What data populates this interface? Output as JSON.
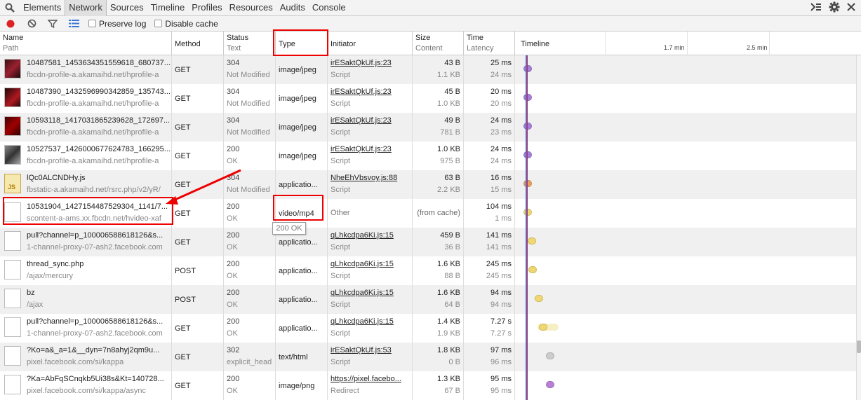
{
  "tabs": [
    "Elements",
    "Network",
    "Sources",
    "Timeline",
    "Profiles",
    "Resources",
    "Audits",
    "Console"
  ],
  "toolbar": {
    "preserve_log": "Preserve log",
    "disable_cache": "Disable cache"
  },
  "header": {
    "name": "Name",
    "path": "Path",
    "method": "Method",
    "status": "Status",
    "text": "Text",
    "type": "Type",
    "initiator": "Initiator",
    "size": "Size",
    "content": "Content",
    "time": "Time",
    "latency": "Latency",
    "timeline": "Timeline",
    "tick1": "1.7 min",
    "tick2": "2.5 min"
  },
  "tooltip": "200 OK",
  "rows": [
    {
      "name": "10487581_1453634351559618_680737...",
      "path": "fbcdn-profile-a.akamaihd.net/hprofile-a",
      "method": "GET",
      "status": "304",
      "text": "Not Modified",
      "type": "image/jpeg",
      "initiator": "irESaktQkUf.js:23",
      "init_type": "Script",
      "size": "43 B",
      "content": "1.1 KB",
      "time": "25 ms",
      "latency": "24 ms",
      "dot_color": "#a77fd6"
    },
    {
      "name": "10487390_1432596990342859_135743...",
      "path": "fbcdn-profile-a.akamaihd.net/hprofile-a",
      "method": "GET",
      "status": "304",
      "text": "Not Modified",
      "type": "image/jpeg",
      "initiator": "irESaktQkUf.js:23",
      "init_type": "Script",
      "size": "45 B",
      "content": "1.0 KB",
      "time": "20 ms",
      "latency": "20 ms",
      "dot_color": "#a77fd6"
    },
    {
      "name": "10593118_1417031865239628_172697...",
      "path": "fbcdn-profile-a.akamaihd.net/hprofile-a",
      "method": "GET",
      "status": "304",
      "text": "Not Modified",
      "type": "image/jpeg",
      "initiator": "irESaktQkUf.js:23",
      "init_type": "Script",
      "size": "49 B",
      "content": "781 B",
      "time": "24 ms",
      "latency": "23 ms",
      "dot_color": "#a77fd6"
    },
    {
      "name": "10527537_1426000677624783_166295...",
      "path": "fbcdn-profile-a.akamaihd.net/hprofile-a",
      "method": "GET",
      "status": "200",
      "text": "OK",
      "type": "image/jpeg",
      "initiator": "irESaktQkUf.js:23",
      "init_type": "Script",
      "size": "1.0 KB",
      "content": "975 B",
      "time": "24 ms",
      "latency": "24 ms",
      "dot_color": "#a77fd6"
    },
    {
      "name": "lQc0ALCNDHy.js",
      "path": "fbstatic-a.akamaihd.net/rsrc.php/v2/yR/",
      "method": "GET",
      "status": "304",
      "text": "Not Modified",
      "type": "applicatio...",
      "initiator": "NheEhVbsvoy.js:88",
      "init_type": "Script",
      "size": "63 B",
      "content": "2.2 KB",
      "time": "16 ms",
      "latency": "15 ms",
      "dot_color": "#e8a060"
    },
    {
      "name": "10531904_1427154487529304_1141/7...",
      "path": "scontent-a-ams.xx.fbcdn.net/hvideo-xaf",
      "method": "GET",
      "status": "200",
      "text": "OK",
      "type": "video/mp4",
      "initiator": "Other",
      "init_type": "",
      "size": "(from cache)",
      "content": "",
      "time": "104 ms",
      "latency": "1 ms",
      "dot_color": "#f0d870"
    },
    {
      "name": "pull?channel=p_100006588618126&s...",
      "path": "1-channel-proxy-07-ash2.facebook.com",
      "method": "GET",
      "status": "200",
      "text": "OK",
      "type": "applicatio...",
      "initiator": "qLhkcdpa6Ki.js:15",
      "init_type": "Script",
      "size": "459 B",
      "content": "36 B",
      "time": "141 ms",
      "latency": "141 ms",
      "dot_color": "#f0d870"
    },
    {
      "name": "thread_sync.php",
      "path": "/ajax/mercury",
      "method": "POST",
      "status": "200",
      "text": "OK",
      "type": "applicatio...",
      "initiator": "qLhkcdpa6Ki.js:15",
      "init_type": "Script",
      "size": "1.6 KB",
      "content": "88 B",
      "time": "245 ms",
      "latency": "245 ms",
      "dot_color": "#f0d870"
    },
    {
      "name": "bz",
      "path": "/ajax",
      "method": "POST",
      "status": "200",
      "text": "OK",
      "type": "applicatio...",
      "initiator": "qLhkcdpa6Ki.js:15",
      "init_type": "Script",
      "size": "1.6 KB",
      "content": "64 B",
      "time": "94 ms",
      "latency": "94 ms",
      "dot_color": "#f0d870"
    },
    {
      "name": "pull?channel=p_100006588618126&s...",
      "path": "1-channel-proxy-07-ash2.facebook.com",
      "method": "GET",
      "status": "200",
      "text": "OK",
      "type": "applicatio...",
      "initiator": "qLhkcdpa6Ki.js:15",
      "init_type": "Script",
      "size": "1.4 KB",
      "content": "1.9 KB",
      "time": "7.27 s",
      "latency": "7.27 s",
      "dot_color": "#f0d870"
    },
    {
      "name": "?Ko=a&_a=1&__dyn=7n8ahyj2qm9u...",
      "path": "pixel.facebook.com/si/kappa",
      "method": "GET",
      "status": "302",
      "text": "explicit_head",
      "type": "text/html",
      "initiator": "irESaktQkUf.js:53",
      "init_type": "Script",
      "size": "1.8 KB",
      "content": "0 B",
      "time": "97 ms",
      "latency": "96 ms",
      "dot_color": "#cccccc"
    },
    {
      "name": "?Ka=AbFqSCnqkb5Ui38s&Kt=140728...",
      "path": "pixel.facebook.com/si/kappa/async",
      "method": "GET",
      "status": "200",
      "text": "OK",
      "type": "image/png",
      "initiator": "https://pixel.facebo...",
      "init_type": "Redirect",
      "size": "1.3 KB",
      "content": "67 B",
      "time": "95 ms",
      "latency": "95 ms",
      "dot_color": "#b77fd6"
    }
  ],
  "colors": {
    "record": "#d22",
    "annotation": "#e00",
    "marker_blue": "#4a6bd8",
    "marker_red": "#d23"
  }
}
